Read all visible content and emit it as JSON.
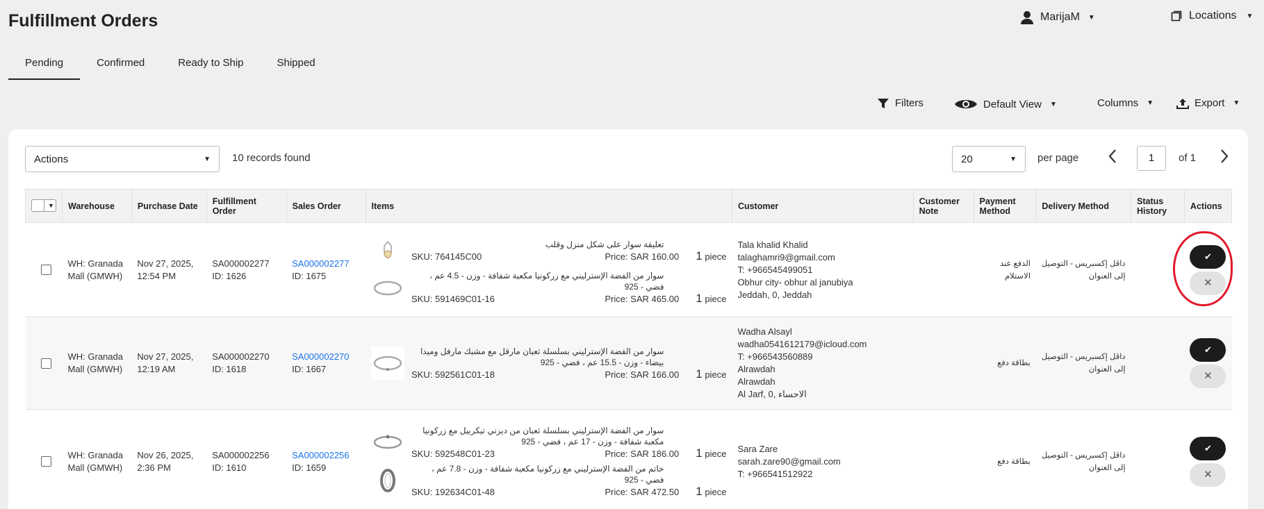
{
  "header": {
    "title": "Fulfillment Orders",
    "user": "MarijaM",
    "locations": "Locations"
  },
  "tabs": [
    {
      "label": "Pending"
    },
    {
      "label": "Confirmed"
    },
    {
      "label": "Ready to Ship"
    },
    {
      "label": "Shipped"
    }
  ],
  "toolbar": {
    "filters": "Filters",
    "view": "Default View",
    "columns": "Columns",
    "export": "Export"
  },
  "list": {
    "actions_label": "Actions",
    "records": "10 records found",
    "per_page_value": "20",
    "per_page_label": "per page",
    "page": "1",
    "of": "of 1"
  },
  "columns": [
    "Warehouse",
    "Purchase Date",
    "Fulfillment Order",
    "Sales Order",
    "Items",
    "Customer",
    "Customer Note",
    "Payment Method",
    "Delivery Method",
    "Status History",
    "Actions"
  ],
  "rows": [
    {
      "warehouse": "WH: Granada Mall (GMWH)",
      "date": "Nov 27, 2025, 12:54 PM",
      "fo": "SA000002277",
      "fo_id": "ID: 1626",
      "so": "SA000002277",
      "so_id": "ID: 1675",
      "items": [
        {
          "name": "تعليقة سوار على شكل منزل وقلب",
          "sku": "SKU: 764145C00",
          "price": "Price: SAR 160.00",
          "qty": "1",
          "unit": "piece"
        },
        {
          "name": "سوار من الفضة الإسترليني مع زركونيا مكعبة شفافة - وزن - 4.5 عم ، فضي - 925",
          "sku": "SKU: 591469C01-16",
          "price": "Price: SAR 465.00",
          "qty": "1",
          "unit": "piece"
        }
      ],
      "customer": [
        "Tala khalid Khalid",
        "talaghamri9@gmail.com",
        "T: +966545499051",
        "Obhur city- obhur al janubiya",
        "Jeddah, 0, Jeddah"
      ],
      "payment": "الدفع عند الاستلام",
      "delivery": "داڤل إكسبريس - التوصيل إلى العنوان"
    },
    {
      "warehouse": "WH: Granada Mall (GMWH)",
      "date": "Nov 27, 2025, 12:19 AM",
      "fo": "SA000002270",
      "fo_id": "ID: 1618",
      "so": "SA000002270",
      "so_id": "ID: 1667",
      "items": [
        {
          "name": "سوار من الفضة الإسترليني بسلسلة ثعبان مارقل مع مشبك مارفل وميدا بيضاء - وزن - 15.5 عم ، فضي - 925",
          "sku": "SKU: 592561C01-18",
          "price": "Price: SAR 166.00",
          "qty": "1",
          "unit": "piece"
        }
      ],
      "customer": [
        "Wadha Alsayl",
        "wadha0541612179@icloud.com",
        "T: +966543560889",
        "Alrawdah",
        "Alrawdah",
        "Al Jarf, 0, الاحساء"
      ],
      "payment": "بطاقة دفع",
      "delivery": "داڤل إكسبريس - التوصيل إلى العنوان"
    },
    {
      "warehouse": "WH: Granada Mall (GMWH)",
      "date": "Nov 26, 2025, 2:36 PM",
      "fo": "SA000002256",
      "fo_id": "ID: 1610",
      "so": "SA000002256",
      "so_id": "ID: 1659",
      "items": [
        {
          "name": "سوار من الفضة الإسترليني بسلسلة ثعبان من ديزني تيكربيل مع زركونيا مكعبة شفافة - وزن - 17 عم ، فضي - 925",
          "sku": "SKU: 592548C01-23",
          "price": "Price: SAR 186.00",
          "qty": "1",
          "unit": "piece"
        },
        {
          "name": "خاتم من الفضة الإسترليني مع زركونيا مكعبة شفافة - وزن - 7.8 عم ، فضي - 925",
          "sku": "SKU: 192634C01-48",
          "price": "Price: SAR 472.50",
          "qty": "1",
          "unit": "piece"
        }
      ],
      "customer": [
        "Sara Zare",
        "sarah.zare90@gmail.com",
        "T: +966541512922"
      ],
      "payment": "بطاقة دفع",
      "delivery": "داڤل إكسبريس - التوصيل إلى العنوان"
    }
  ]
}
